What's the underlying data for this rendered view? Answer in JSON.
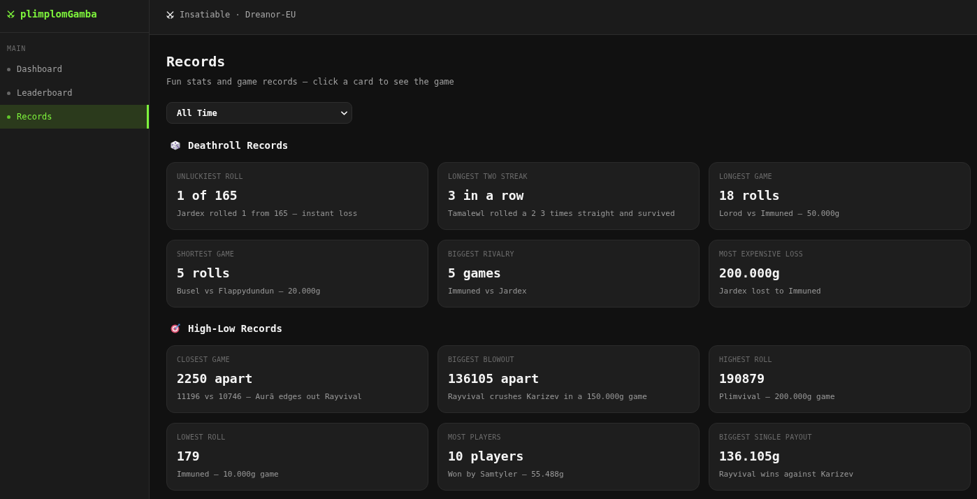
{
  "sidebar": {
    "logo": "plimplomGamba",
    "section_label": "MAIN",
    "items": [
      {
        "label": "Dashboard",
        "selected": false
      },
      {
        "label": "Leaderboard",
        "selected": false
      },
      {
        "label": "Records",
        "selected": true
      }
    ]
  },
  "topbar": {
    "text": "Insatiable · Dreanor-EU"
  },
  "page": {
    "title": "Records",
    "subtitle": "Fun stats and game records — click a card to see the game"
  },
  "filter": {
    "value": "All Time"
  },
  "sections": [
    {
      "title": "Deathroll Records",
      "kind": "deathroll",
      "cards": [
        {
          "label": "UNLUCKIEST ROLL",
          "value": "1 of 165",
          "detail": "Jardex rolled 1 from 165 — instant loss"
        },
        {
          "label": "LONGEST TWO STREAK",
          "value": "3 in a row",
          "detail": "Tamalewl rolled a 2 3 times straight and survived"
        },
        {
          "label": "LONGEST GAME",
          "value": "18 rolls",
          "detail": "Lorod vs Immuned — 50.000g"
        },
        {
          "label": "SHORTEST GAME",
          "value": "5 rolls",
          "detail": "Busel vs Flappydundun — 20.000g"
        },
        {
          "label": "BIGGEST RIVALRY",
          "value": "5 games",
          "detail": "Immuned vs Jardex"
        },
        {
          "label": "MOST EXPENSIVE LOSS",
          "value": "200.000g",
          "detail": "Jardex lost to Immuned"
        }
      ]
    },
    {
      "title": "High-Low Records",
      "kind": "high-low",
      "cards": [
        {
          "label": "CLOSEST GAME",
          "value": "2250 apart",
          "detail": "11196 vs 10746 — Aurā edges out Rayvival"
        },
        {
          "label": "BIGGEST BLOWOUT",
          "value": "136105 apart",
          "detail": "Rayvival crushes Karizev in a 150.000g game"
        },
        {
          "label": "HIGHEST ROLL",
          "value": "190879",
          "detail": "Plimvival — 200.000g game"
        },
        {
          "label": "LOWEST ROLL",
          "value": "179",
          "detail": "Immuned — 10.000g game"
        },
        {
          "label": "MOST PLAYERS",
          "value": "10 players",
          "detail": "Won by Samtyler — 55.488g"
        },
        {
          "label": "BIGGEST SINGLE PAYOUT",
          "value": "136.105g",
          "detail": "Rayvival wins against Karizev"
        }
      ]
    }
  ]
}
